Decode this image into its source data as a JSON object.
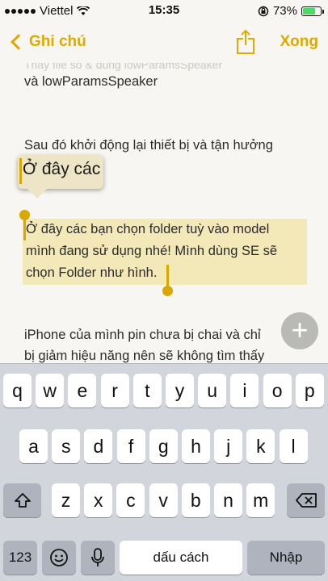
{
  "status": {
    "carrier": "Viettel",
    "time": "15:35",
    "battery": "73%",
    "battery_level": 0.73
  },
  "nav": {
    "back_label": "Ghi chú",
    "done_label": "Xong"
  },
  "note": {
    "faded_top": "Thay file so & dung lowParamsSpeaker",
    "line1": "và lowParamsSpeaker",
    "line2": "Sau đó khởi động lại thiết bị và tận hưởng",
    "selected": [
      "Ở đây các bạn chọn folder tuỳ vào model",
      "mình đang sử dụng nhé! Mình dùng SE sẽ",
      "chọn Folder như hình."
    ],
    "line_after1": "iPhone của mình pin chưa bị chai và chỉ",
    "line_after2": "bị giảm hiệu năng nên sẽ không tìm thấy"
  },
  "magnifier": {
    "text": "Ở đây các"
  },
  "plus": "+",
  "keyboard": {
    "row1": [
      "q",
      "w",
      "e",
      "r",
      "t",
      "y",
      "u",
      "i",
      "o",
      "p"
    ],
    "row2": [
      "a",
      "s",
      "d",
      "f",
      "g",
      "h",
      "j",
      "k",
      "l"
    ],
    "row3": [
      "z",
      "x",
      "c",
      "v",
      "b",
      "n",
      "m"
    ],
    "numbers_label": "123",
    "space_label": "dấu cách",
    "return_label": "Nhập"
  }
}
